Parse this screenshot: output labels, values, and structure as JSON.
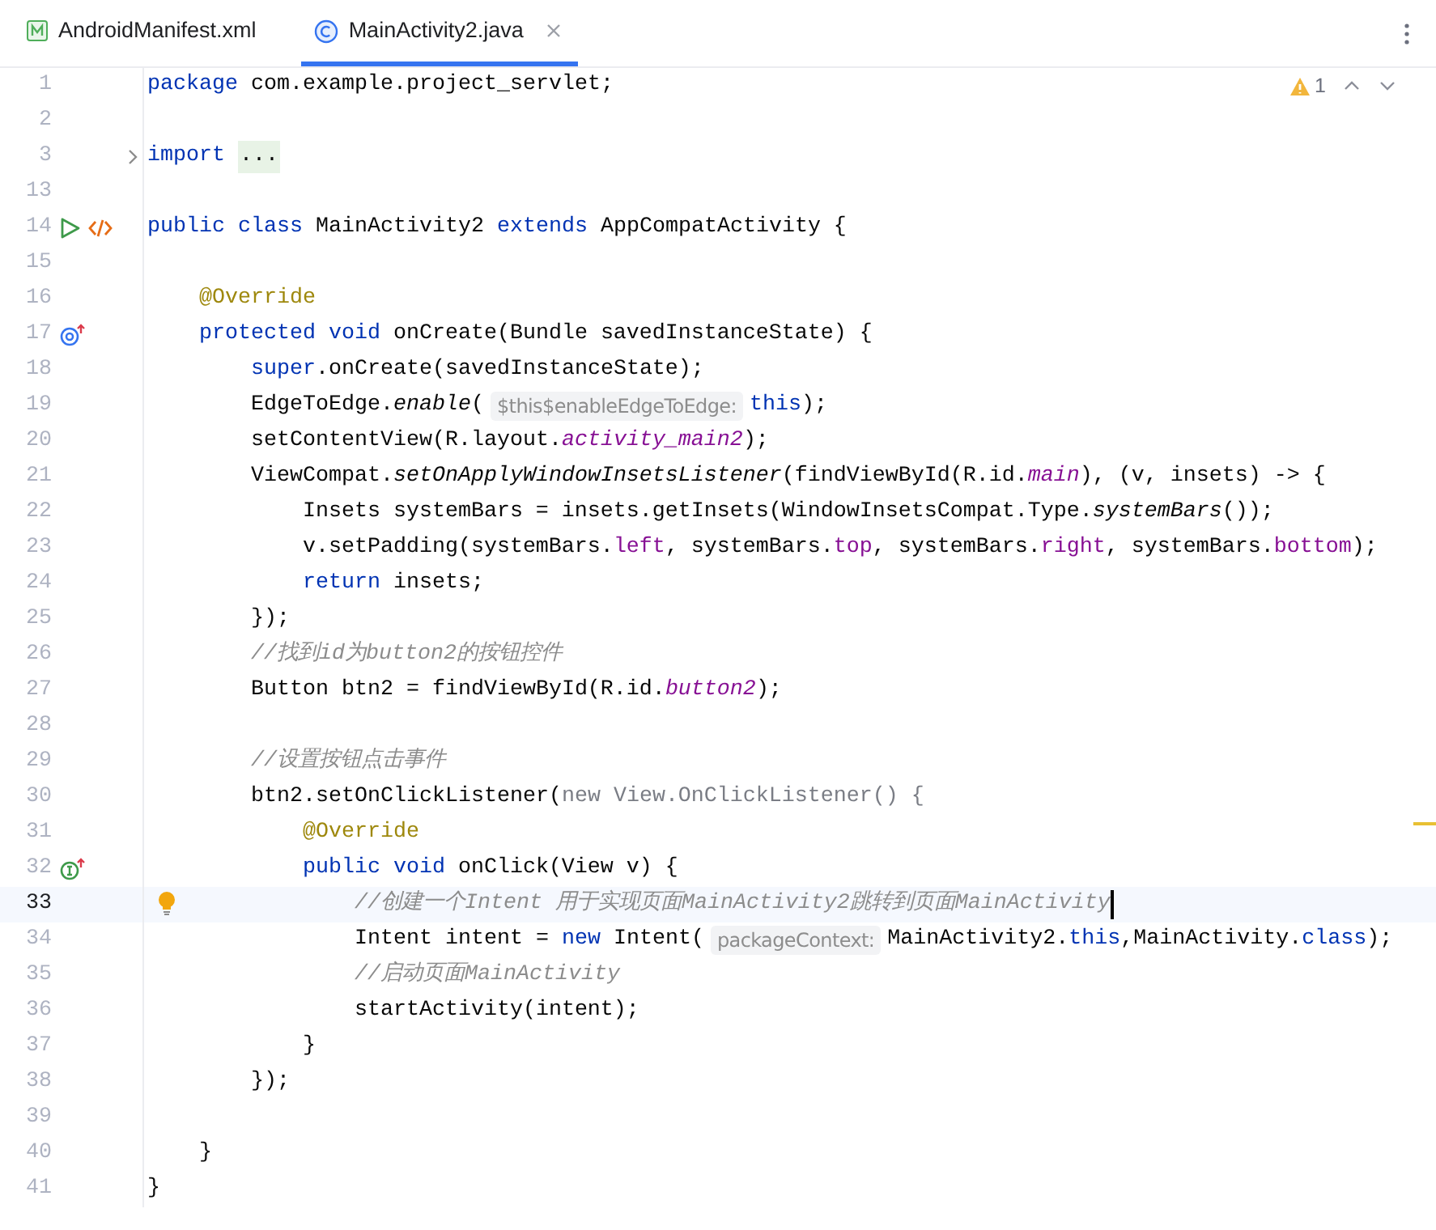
{
  "tabs": [
    {
      "label": "AndroidManifest.xml",
      "kind": "manifest",
      "selected": false,
      "closable": false
    },
    {
      "label": "MainActivity2.java",
      "kind": "class",
      "selected": true,
      "closable": true
    }
  ],
  "inspection": {
    "count": "1"
  },
  "lines": [
    {
      "number": "1",
      "current": false,
      "tokens": [
        {
          "kind": "keyword",
          "text": "package"
        },
        {
          "kind": "plain",
          "text": " com.example.project_servlet;"
        }
      ]
    },
    {
      "number": "2",
      "current": false
    },
    {
      "number": "3",
      "current": false,
      "gutter": [
        {
          "kind": "fold"
        }
      ],
      "tokens": [
        {
          "kind": "keyword",
          "text": "import "
        },
        {
          "kind": "folded",
          "text": "..."
        }
      ]
    },
    {
      "number": "13",
      "current": false
    },
    {
      "number": "14",
      "current": false,
      "gutter": [
        {
          "kind": "run"
        },
        {
          "kind": "code"
        }
      ],
      "tokens": [
        {
          "kind": "keyword",
          "text": "public class"
        },
        {
          "kind": "plain",
          "text": " MainActivity2 "
        },
        {
          "kind": "keyword",
          "text": "extends"
        },
        {
          "kind": "plain",
          "text": " AppCompatActivity {"
        }
      ]
    },
    {
      "number": "15",
      "current": false
    },
    {
      "number": "16",
      "current": false,
      "tokens": [
        {
          "kind": "annotation",
          "text": "    @Override"
        }
      ]
    },
    {
      "number": "17",
      "current": false,
      "gutter": [
        {
          "kind": "override"
        }
      ],
      "tokens": [
        {
          "kind": "keyword",
          "text": "    protected void"
        },
        {
          "kind": "plain",
          "text": " onCreate(Bundle savedInstanceState) {"
        }
      ]
    },
    {
      "number": "18",
      "current": false,
      "tokens": [
        {
          "kind": "keyword",
          "text": "        super"
        },
        {
          "kind": "plain",
          "text": ".onCreate(savedInstanceState);"
        }
      ]
    },
    {
      "number": "19",
      "current": false,
      "tokens": [
        {
          "kind": "plain",
          "text": "        EdgeToEdge."
        },
        {
          "kind": "static",
          "text": "enable"
        },
        {
          "kind": "plain",
          "text": "("
        },
        {
          "kind": "hint",
          "text": "$this$enableEdgeToEdge:"
        },
        {
          "kind": "keyword",
          "text": "this"
        },
        {
          "kind": "plain",
          "text": ");"
        }
      ]
    },
    {
      "number": "20",
      "current": false,
      "tokens": [
        {
          "kind": "plain",
          "text": "        setContentView(R.layout."
        },
        {
          "kind": "staticfield",
          "text": "activity_main2"
        },
        {
          "kind": "plain",
          "text": ");"
        }
      ]
    },
    {
      "number": "21",
      "current": false,
      "tokens": [
        {
          "kind": "plain",
          "text": "        ViewCompat."
        },
        {
          "kind": "static",
          "text": "setOnApplyWindowInsetsListener"
        },
        {
          "kind": "plain",
          "text": "(findViewById(R.id."
        },
        {
          "kind": "staticfield",
          "text": "main"
        },
        {
          "kind": "plain",
          "text": "), (v, insets) -> {"
        }
      ]
    },
    {
      "number": "22",
      "current": false,
      "tokens": [
        {
          "kind": "plain",
          "text": "            Insets systemBars = insets.getInsets(WindowInsetsCompat.Type."
        },
        {
          "kind": "static",
          "text": "systemBars"
        },
        {
          "kind": "plain",
          "text": "());"
        }
      ]
    },
    {
      "number": "23",
      "current": false,
      "tokens": [
        {
          "kind": "plain",
          "text": "            v.setPadding(systemBars."
        },
        {
          "kind": "field",
          "text": "left"
        },
        {
          "kind": "plain",
          "text": ", systemBars."
        },
        {
          "kind": "field",
          "text": "top"
        },
        {
          "kind": "plain",
          "text": ", systemBars."
        },
        {
          "kind": "field",
          "text": "right"
        },
        {
          "kind": "plain",
          "text": ", systemBars."
        },
        {
          "kind": "field",
          "text": "bottom"
        },
        {
          "kind": "plain",
          "text": ");"
        }
      ]
    },
    {
      "number": "24",
      "current": false,
      "tokens": [
        {
          "kind": "keyword",
          "text": "            return"
        },
        {
          "kind": "plain",
          "text": " insets;"
        }
      ]
    },
    {
      "number": "25",
      "current": false,
      "tokens": [
        {
          "kind": "plain",
          "text": "        });"
        }
      ]
    },
    {
      "number": "26",
      "current": false,
      "tokens": [
        {
          "kind": "comment",
          "text": "        //找到id为button2的按钮控件"
        }
      ]
    },
    {
      "number": "27",
      "current": false,
      "tokens": [
        {
          "kind": "plain",
          "text": "        Button btn2 = findViewById(R.id."
        },
        {
          "kind": "staticfield",
          "text": "button2"
        },
        {
          "kind": "plain",
          "text": ");"
        }
      ]
    },
    {
      "number": "28",
      "current": false
    },
    {
      "number": "29",
      "current": false,
      "tokens": [
        {
          "kind": "comment",
          "text": "        //设置按钮点击事件"
        }
      ]
    },
    {
      "number": "30",
      "current": false,
      "tokens": [
        {
          "kind": "plain",
          "text": "        btn2.setOnClickListener("
        },
        {
          "kind": "dimmed",
          "text": "new View.OnClickListener() {"
        }
      ]
    },
    {
      "number": "31",
      "current": false,
      "tokens": [
        {
          "kind": "annotation",
          "text": "            @Override"
        }
      ]
    },
    {
      "number": "32",
      "current": false,
      "gutter": [
        {
          "kind": "implements"
        }
      ],
      "tokens": [
        {
          "kind": "keyword",
          "text": "            public void"
        },
        {
          "kind": "plain",
          "text": " onClick(View v) {"
        }
      ]
    },
    {
      "number": "33",
      "current": true,
      "gutter": [
        {
          "kind": "bulb"
        }
      ],
      "tokens": [
        {
          "kind": "comment",
          "text": "                //创建一个Intent 用于实现页面MainActivity2跳转到页面MainActivity"
        }
      ]
    },
    {
      "number": "34",
      "current": false,
      "tokens": [
        {
          "kind": "plain",
          "text": "                Intent intent = "
        },
        {
          "kind": "keyword",
          "text": "new"
        },
        {
          "kind": "plain",
          "text": " Intent("
        },
        {
          "kind": "hint",
          "text": "packageContext:"
        },
        {
          "kind": "plain",
          "text": "MainActivity2."
        },
        {
          "kind": "keyword",
          "text": "this"
        },
        {
          "kind": "plain",
          "text": ",MainActivity."
        },
        {
          "kind": "keyword",
          "text": "class"
        },
        {
          "kind": "plain",
          "text": ");"
        }
      ]
    },
    {
      "number": "35",
      "current": false,
      "tokens": [
        {
          "kind": "comment",
          "text": "                //启动页面MainActivity"
        }
      ]
    },
    {
      "number": "36",
      "current": false,
      "tokens": [
        {
          "kind": "plain",
          "text": "                startActivity(intent);"
        }
      ]
    },
    {
      "number": "37",
      "current": false,
      "tokens": [
        {
          "kind": "plain",
          "text": "            }"
        }
      ]
    },
    {
      "number": "38",
      "current": false,
      "tokens": [
        {
          "kind": "plain",
          "text": "        });"
        }
      ]
    },
    {
      "number": "39",
      "current": false
    },
    {
      "number": "40",
      "current": false,
      "tokens": [
        {
          "kind": "plain",
          "text": "    }"
        }
      ]
    },
    {
      "number": "41",
      "current": false,
      "tokens": [
        {
          "kind": "plain",
          "text": "}"
        }
      ]
    }
  ]
}
